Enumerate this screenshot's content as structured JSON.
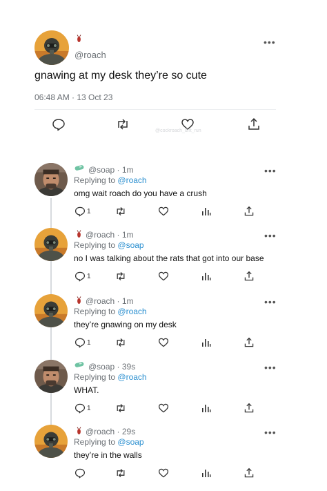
{
  "main_tweet": {
    "handle": "@roach",
    "text": "gnawing at my desk they’re so cute",
    "timestamp": "06:48 AM · 13 Oct 23",
    "watermark": "@cockroach_dnt_run"
  },
  "replies": [
    {
      "handle": "@soap",
      "time": "1m",
      "replying_label": "Replying to",
      "replying_to": "@roach",
      "text": "omg wait roach do you have a crush",
      "reply_count": "1",
      "user": "soap"
    },
    {
      "handle": "@roach",
      "time": "1m",
      "replying_label": "Replying to",
      "replying_to": "@soap",
      "text": "no I was talking about the rats that got into our base",
      "reply_count": "1",
      "user": "roach"
    },
    {
      "handle": "@roach",
      "time": "1m",
      "replying_label": "Replying to",
      "replying_to": "@roach",
      "text": "they’re gnawing on my desk",
      "reply_count": "1",
      "user": "roach"
    },
    {
      "handle": "@soap",
      "time": "39s",
      "replying_label": "Replying to",
      "replying_to": "@roach",
      "text": "WHAT.",
      "reply_count": "1",
      "user": "soap"
    },
    {
      "handle": "@roach",
      "time": "29s",
      "replying_label": "Replying to",
      "replying_to": "@soap",
      "text": "they’re in the walls",
      "reply_count": "",
      "user": "roach"
    }
  ],
  "separator": " · ",
  "more_label": "•••",
  "colors": {
    "link": "#2a8fd0",
    "muted": "#6b7075",
    "soap_badge": "#6fc3a3",
    "roach_badge": "#b8342c",
    "thread_line": "#d7dade"
  },
  "icons": [
    "roach-badge-icon",
    "soap-badge-icon",
    "reply-icon",
    "retweet-icon",
    "like-icon",
    "share-icon",
    "views-icon",
    "more-icon"
  ]
}
